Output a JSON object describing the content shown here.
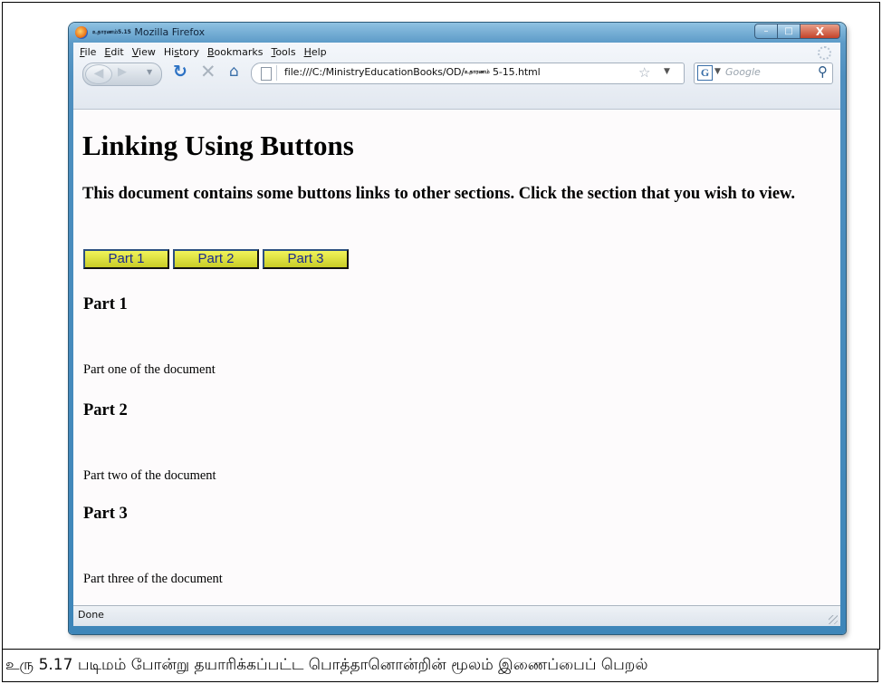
{
  "window": {
    "title_tamil": "உதாரணம்5.15",
    "title_app": "Mozilla Firefox",
    "controls": {
      "minimize": "–",
      "maximize": "□",
      "close": "X"
    }
  },
  "menu": [
    {
      "key": "F",
      "rest": "ile"
    },
    {
      "key": "E",
      "rest": "dit"
    },
    {
      "key": "V",
      "rest": "iew"
    },
    {
      "pre": "Hi",
      "key": "s",
      "rest": "tory"
    },
    {
      "key": "B",
      "rest": "ookmarks"
    },
    {
      "key": "T",
      "rest": "ools"
    },
    {
      "key": "H",
      "rest": "elp"
    }
  ],
  "address": {
    "prefix": "file:///C:/MinistryEducationBooks/OD/",
    "tamil": "உதாரணம்",
    "suffix": " 5-15.html"
  },
  "search": {
    "engine_letter": "G",
    "placeholder": "Google"
  },
  "page": {
    "heading": "Linking Using Buttons",
    "intro": "This document contains some buttons links to other sections. Click the section that you wish to view.",
    "buttons": [
      "Part 1",
      "Part 2",
      "Part 3"
    ],
    "sections": [
      {
        "heading": "Part 1",
        "text": "Part one of the document"
      },
      {
        "heading": "Part 2",
        "text": "Part two of the document"
      },
      {
        "heading": "Part 3",
        "text": "Part three of the document"
      }
    ]
  },
  "status": "Done",
  "caption": "உரு 5.17 படிமம் போன்று தயாரிக்கப்பட்ட பொத்தானொன்றின் மூலம் இணைப்பைப் பெறல்"
}
